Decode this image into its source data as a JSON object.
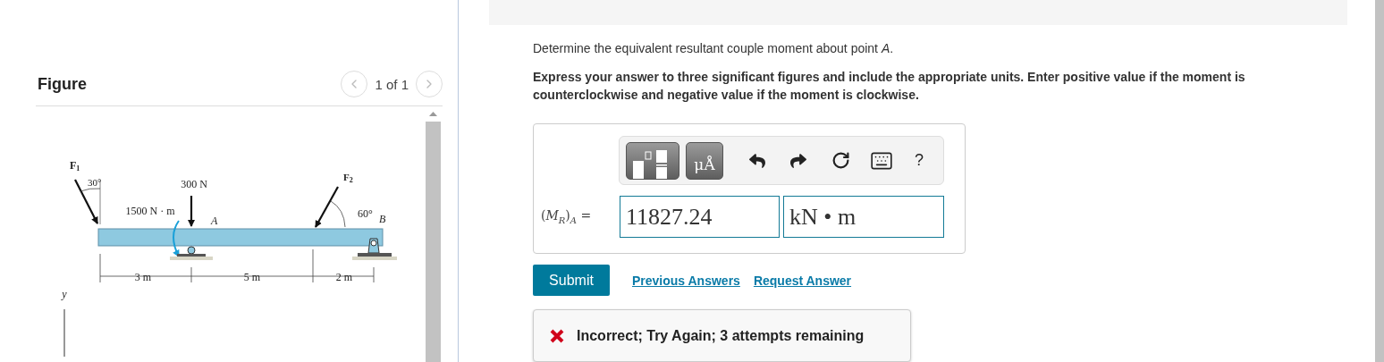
{
  "figure_panel": {
    "title": "Figure",
    "pager": "1 of 1",
    "labels": [
      {
        "text": "F",
        "sub": "1"
      },
      {
        "text": "30°"
      },
      {
        "text": "300 N"
      },
      {
        "text": "1500 N · m"
      },
      {
        "text": "A"
      },
      {
        "text": "F",
        "sub": "2"
      },
      {
        "text": "60°"
      },
      {
        "text": "B"
      },
      {
        "text": "3 m"
      },
      {
        "text": "5 m"
      },
      {
        "text": "2 m"
      },
      {
        "text": "y"
      }
    ]
  },
  "question": "Determine the equivalent resultant couple moment about point *A*.",
  "instructions": "Express your answer to three significant figures and include the appropriate units. Enter positive value if the moment is counterclockwise and negative value if the moment is clockwise.",
  "toolbar": [
    {
      "kind": "templates"
    },
    {
      "kind": "symbols",
      "label": "μÅ"
    },
    {
      "kind": "undo"
    },
    {
      "kind": "redo"
    },
    {
      "kind": "reset"
    },
    {
      "kind": "keyboard"
    },
    {
      "kind": "help",
      "label": "?"
    }
  ],
  "answer": {
    "label": "(*M*$_{R}$)$_{A}$ =",
    "value": "11827.24",
    "units": "kN • m"
  },
  "actions": {
    "submit": "Submit",
    "links": [
      "Previous Answers",
      "Request Answer"
    ]
  },
  "feedback": {
    "text": "Incorrect; Try Again; 3 attempts remaining"
  }
}
